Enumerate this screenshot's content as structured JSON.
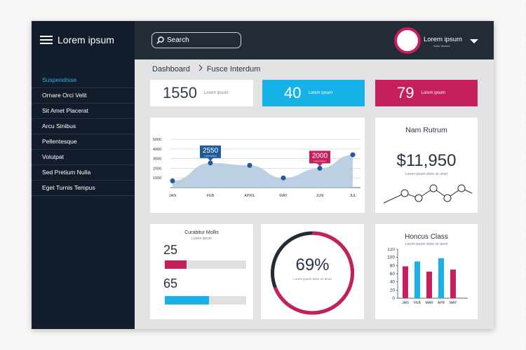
{
  "app": {
    "title": "Lorem ipsum"
  },
  "search": {
    "placeholder": "Search"
  },
  "user": {
    "name": "Lorem ipsum",
    "role": "Dolor sitamet"
  },
  "sidebar": {
    "items": [
      {
        "label": "Suspendisse",
        "active": true
      },
      {
        "label": "Ornare Orci Velit"
      },
      {
        "label": "Sit Amet Placerat"
      },
      {
        "label": "Arcu Sinibus"
      },
      {
        "label": "Pellentesque"
      },
      {
        "label": "Volutpat"
      },
      {
        "label": "Sed Pretium Nulla"
      },
      {
        "label": "Eget Turnis Tempus"
      }
    ]
  },
  "breadcrumb": {
    "root": "Dashboard",
    "current": "Fusce Interdum"
  },
  "stats": [
    {
      "value": "1550",
      "label": "Lorem ipsum",
      "color": "#ffffff"
    },
    {
      "value": "40",
      "label": "Lorem ipsum",
      "color": "#17b2e8"
    },
    {
      "value": "79",
      "label": "Lorem ipsum",
      "color": "#c51f5d"
    }
  ],
  "area_chart": {
    "callout_1": "2550",
    "callout_1_sub": "Lorem ipsum",
    "callout_2": "2000",
    "callout_2_sub": "Lorem ipsum"
  },
  "nam_rutrum": {
    "title": "Nam Rutrum",
    "value": "$11,950",
    "subtitle": "Lorem ipsum dolor sir amet"
  },
  "curabitur": {
    "title": "Curabitur Mollis",
    "subtitle": "Lorem ipsum",
    "bar1": {
      "value": "25",
      "fraction": 0.27,
      "color": "#c51f5d"
    },
    "bar2": {
      "value": "65",
      "fraction": 0.54,
      "color": "#17b2e8"
    }
  },
  "donut": {
    "value": "69%",
    "subtitle": "Lorem ipsum dolor sir amet",
    "fraction": 0.69,
    "color": "#c51f5d",
    "track": "#232b39"
  },
  "honcus": {
    "title": "Honcus Class",
    "subtitle": "Lorem ipsum dolor sir amet"
  },
  "chart_data": [
    {
      "type": "area",
      "categories": [
        "JAN",
        "FEB",
        "APRIL",
        "MAY",
        "JUN",
        "JUL"
      ],
      "values": [
        700,
        2550,
        2300,
        1000,
        2000,
        3400
      ],
      "yticks": [
        1000,
        2000,
        3000,
        4000,
        5000
      ],
      "ylim": [
        0,
        5000
      ],
      "grid": true
    },
    {
      "type": "line",
      "values": [
        1,
        3,
        2,
        4,
        2,
        4,
        3
      ],
      "style": "sparkline"
    },
    {
      "type": "bar",
      "categories": [
        "JAN",
        "FEB",
        "MAR",
        "APR",
        "MAY"
      ],
      "series": [
        {
          "values": [
            78,
            90,
            65,
            98,
            70
          ]
        }
      ],
      "colors": [
        "#c51f5d",
        "#17b2e8",
        "#c51f5d",
        "#17b2e8",
        "#c51f5d"
      ],
      "yticks": [
        0,
        20,
        40,
        60,
        80,
        100,
        120
      ],
      "ylim": [
        0,
        120
      ]
    }
  ]
}
